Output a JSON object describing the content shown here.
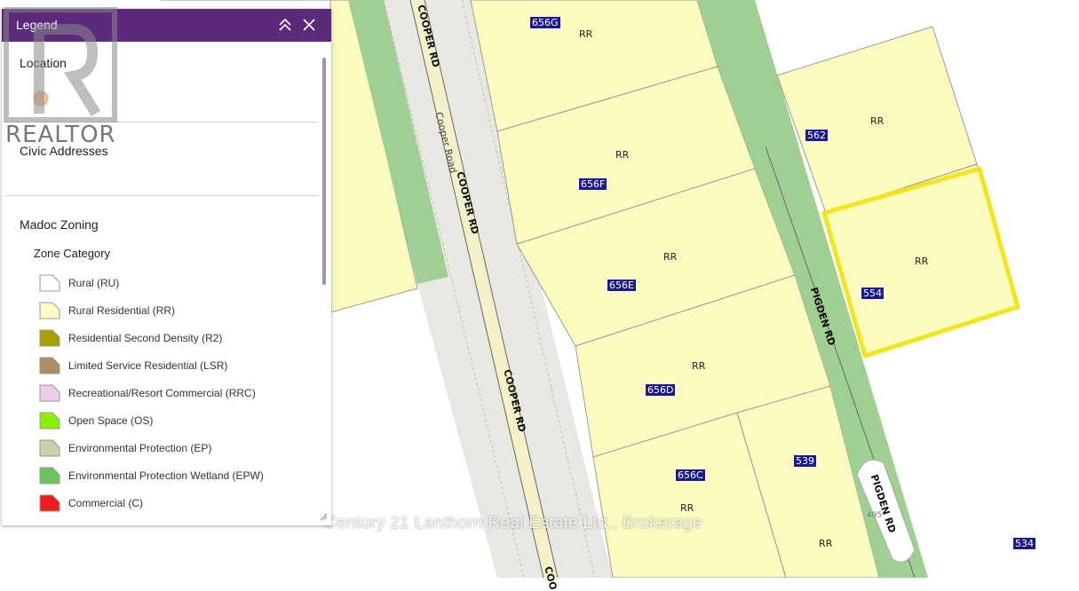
{
  "map": {
    "addresses": [
      "656G",
      "656F",
      "656E",
      "656D",
      "656C",
      "562",
      "554",
      "539",
      "534"
    ],
    "zones": [
      "RR",
      "RR",
      "RR",
      "RR",
      "RR",
      "RR",
      "RR",
      "RR",
      "RR"
    ],
    "roads": [
      "COOPER RD",
      "COOPER RD",
      "COOPER RD",
      "Cooper Road",
      "PIGDEN RD",
      "PIGDEN RD",
      "COO",
      "495"
    ],
    "watermark": "Century 21 Lanthorn Real Estate Ltd., Brokerage",
    "realtor_logo_text": "REALTOR",
    "colors": {
      "rural_residential": "#fbfbc0",
      "green_strip": "#9fcf92",
      "road_surface": "#e9e7e1",
      "highlight": "#f2e41e",
      "address_label": "#1a1a8a"
    }
  },
  "legend": {
    "title": "Legend",
    "header_color": "#5b2a7a",
    "sections": {
      "location": "Location",
      "civic": "Civic Addresses",
      "zoning": "Madoc Zoning",
      "zone_category": "Zone Category"
    },
    "items": [
      {
        "label": "Rural (RU)",
        "color": "#ffffff"
      },
      {
        "label": "Rural Residential (RR)",
        "color": "#fdfdc2"
      },
      {
        "label": "Residential Second Density (R2)",
        "color": "#a8a000"
      },
      {
        "label": "Limited Service Residential (LSR)",
        "color": "#b08a62"
      },
      {
        "label": "Recreational/Resort Commercial (RRC)",
        "color": "#eecbea"
      },
      {
        "label": "Open Space (OS)",
        "color": "#8cf000"
      },
      {
        "label": "Environmental Protection (EP)",
        "color": "#c7d3a6"
      },
      {
        "label": "Environmental Protection Wetland (EPW)",
        "color": "#6cc45e"
      },
      {
        "label": "Commercial (C)",
        "color": "#ee1c1c"
      }
    ]
  }
}
